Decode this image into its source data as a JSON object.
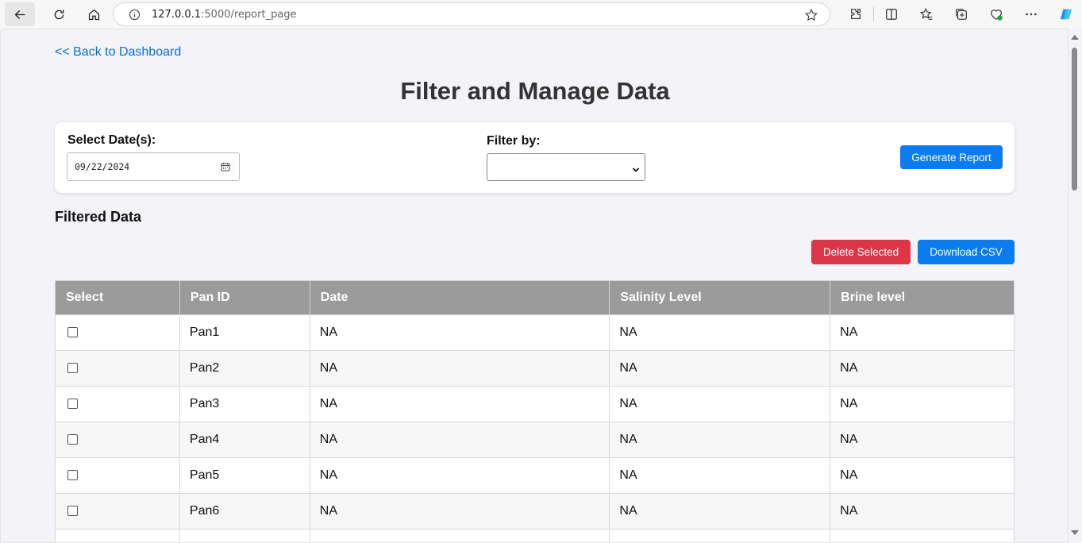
{
  "browser": {
    "url_host": "127.0.0.1",
    "url_path": ":5000/report_page"
  },
  "page": {
    "back_link": "<< Back to Dashboard",
    "title": "Filter and Manage Data"
  },
  "filter": {
    "date_label": "Select Date(s):",
    "date_value": "09/22/2024",
    "filter_label": "Filter by:",
    "filter_value": "",
    "generate_button": "Generate Report"
  },
  "section": {
    "title": "Filtered Data",
    "delete_button": "Delete Selected",
    "download_button": "Download CSV"
  },
  "table": {
    "columns": [
      "Select",
      "Pan ID",
      "Date",
      "Salinity Level",
      "Brine level"
    ],
    "rows": [
      {
        "pan_id": "Pan1",
        "date": "NA",
        "salinity": "NA",
        "brine": "NA"
      },
      {
        "pan_id": "Pan2",
        "date": "NA",
        "salinity": "NA",
        "brine": "NA"
      },
      {
        "pan_id": "Pan3",
        "date": "NA",
        "salinity": "NA",
        "brine": "NA"
      },
      {
        "pan_id": "Pan4",
        "date": "NA",
        "salinity": "NA",
        "brine": "NA"
      },
      {
        "pan_id": "Pan5",
        "date": "NA",
        "salinity": "NA",
        "brine": "NA"
      },
      {
        "pan_id": "Pan6",
        "date": "NA",
        "salinity": "NA",
        "brine": "NA"
      },
      {
        "pan_id": "",
        "date": "",
        "salinity": "",
        "brine": ""
      }
    ]
  },
  "colors": {
    "primary": "#0b7cf0",
    "danger": "#dc3545",
    "header_bg": "#9b9b9b",
    "link": "#0a6fd6"
  }
}
